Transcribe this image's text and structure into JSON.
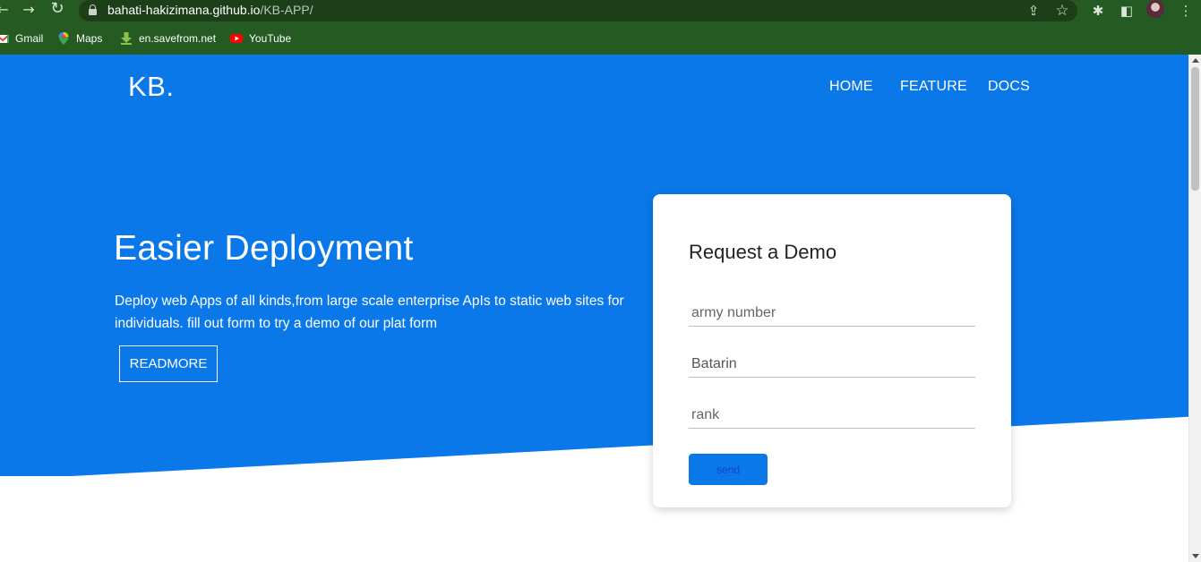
{
  "browser": {
    "url_host": "bahati-hakizimana.github.io",
    "url_path": "/KB-APP/",
    "bookmarks": [
      {
        "label": "Gmail"
      },
      {
        "label": "Maps"
      },
      {
        "label": "en.savefrom.net"
      },
      {
        "label": "YouTube"
      }
    ],
    "icons": {
      "back": "←",
      "forward": "→",
      "reload": "↻",
      "share": "⇪",
      "star": "☆",
      "extensions": "✱",
      "sidepanel": "◧",
      "menu": "⋮"
    }
  },
  "site": {
    "logo": "KB.",
    "nav": [
      {
        "label": "HOME"
      },
      {
        "label": "FEATURE"
      },
      {
        "label": "DOCS"
      }
    ],
    "hero": {
      "title": "Easier Deployment",
      "text": "Deploy web Apps of all kinds,from large scale enterprise ApIs to static web sites for individuals. fill out form to try a demo of our plat form",
      "readmore": "READMORE"
    },
    "demo_form": {
      "title": "Request a Demo",
      "fields": [
        {
          "placeholder": "army number",
          "value": ""
        },
        {
          "placeholder": "",
          "value": "Batarin"
        },
        {
          "placeholder": "rank",
          "value": ""
        }
      ],
      "submit": "send"
    }
  },
  "colors": {
    "chrome": "#255a22",
    "hero_blue": "#0a78e8",
    "white": "#ffffff"
  }
}
